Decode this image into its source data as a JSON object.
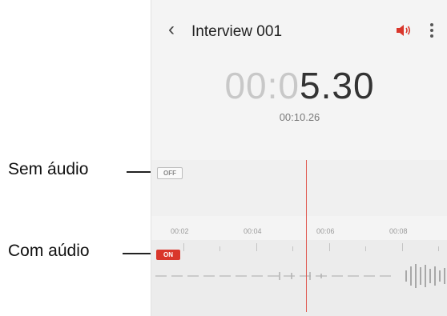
{
  "header": {
    "title": "Interview 001",
    "back_icon": "back-chevron-icon",
    "speaker_icon": "speaker-icon",
    "menu_icon": "more-vert-icon"
  },
  "timer": {
    "elapsed_dim": "00:0",
    "elapsed_bright": "5.30",
    "total": "00:10.26"
  },
  "tracks": {
    "muted_toggle": "OFF",
    "active_toggle": "ON"
  },
  "timeline": {
    "labels": [
      "00:02",
      "00:04",
      "00:06",
      "00:08"
    ]
  },
  "callouts": {
    "without_audio": "Sem áudio",
    "with_audio": "Com aúdio"
  },
  "colors": {
    "accent_red": "#d9362b",
    "playhead": "#e05a52"
  }
}
